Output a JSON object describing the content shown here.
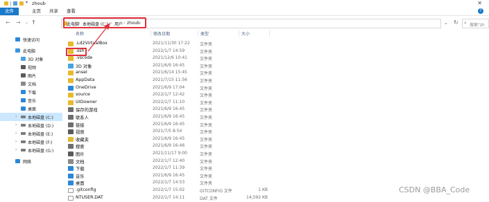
{
  "window": {
    "title": "zhoub"
  },
  "ribbon": {
    "file_tab": "文件",
    "tabs": [
      "主页",
      "共享",
      "查看"
    ],
    "help": "?"
  },
  "nav": {
    "back": "←",
    "forward": "→",
    "recent": "⌄",
    "up": "↑"
  },
  "address": {
    "crumbs": [
      "此电脑",
      "本地磁盘 (C:)",
      "用户",
      "zhoub"
    ],
    "sep": "›"
  },
  "search": {
    "placeholder": "搜索\"zh"
  },
  "sidebar": {
    "items": [
      {
        "label": "快速访问",
        "icon": "star-icon",
        "color": "#2b88d8"
      },
      {
        "label": "此电脑",
        "icon": "computer-icon",
        "color": "#3a96dd"
      },
      {
        "label": "3D 对象",
        "icon": "cube-icon",
        "color": "#4aa3df"
      },
      {
        "label": "视频",
        "icon": "video-icon",
        "color": "#5a5a5a"
      },
      {
        "label": "图片",
        "icon": "picture-icon",
        "color": "#5a5a5a"
      },
      {
        "label": "文档",
        "icon": "document-icon",
        "color": "#8a8a8a"
      },
      {
        "label": "下载",
        "icon": "download-icon",
        "color": "#2b88d8"
      },
      {
        "label": "音乐",
        "icon": "music-icon",
        "color": "#2b88d8"
      },
      {
        "label": "桌面",
        "icon": "desktop-icon",
        "color": "#2b88d8"
      },
      {
        "label": "本地磁盘 (C:)",
        "icon": "drive-icon",
        "color": "#7a7a7a",
        "selected": true
      },
      {
        "label": "本地磁盘 (D:)",
        "icon": "drive-icon",
        "color": "#7a7a7a"
      },
      {
        "label": "本地磁盘 (E:)",
        "icon": "drive-icon",
        "color": "#7a7a7a"
      },
      {
        "label": "本地磁盘 (F:)",
        "icon": "drive-icon",
        "color": "#7a7a7a"
      },
      {
        "label": "本地磁盘 (G:)",
        "icon": "drive-icon",
        "color": "#7a7a7a"
      },
      {
        "label": "网络",
        "icon": "network-icon",
        "color": "#2b88d8"
      }
    ]
  },
  "columns": {
    "name": "名称",
    "date": "修改日期",
    "type": "类型",
    "size": "大小"
  },
  "files": [
    {
      "name": ".Ld2VirtualBox",
      "date": "2021/11/30 17:22",
      "type": "文件夹",
      "size": "",
      "color": "#e8b92f"
    },
    {
      "name": ".ssh",
      "date": "2022/1/7 14:59",
      "type": "文件夹",
      "size": "",
      "color": "#e8b92f"
    },
    {
      "name": ".vscode",
      "date": "2021/12/6 10:41",
      "type": "文件夹",
      "size": "",
      "color": "#e8b92f"
    },
    {
      "name": "3D 对象",
      "date": "2021/6/9 16:45",
      "type": "文件夹",
      "size": "",
      "color": "#4aa3df"
    },
    {
      "name": "ansel",
      "date": "2021/6/14 15:45",
      "type": "文件夹",
      "size": "",
      "color": "#e8b92f"
    },
    {
      "name": "AppData",
      "date": "2021/7/15 11:56",
      "type": "文件夹",
      "size": "",
      "color": "#e8b92f"
    },
    {
      "name": "OneDrive",
      "date": "2021/6/9 17:04",
      "type": "文件夹",
      "size": "",
      "color": "#2b88d8"
    },
    {
      "name": "source",
      "date": "2022/1/7 12:42",
      "type": "文件夹",
      "size": "",
      "color": "#e8b92f"
    },
    {
      "name": "UIDowner",
      "date": "2022/1/7 11:10",
      "type": "文件夹",
      "size": "",
      "color": "#e8b92f"
    },
    {
      "name": "保存的游戏",
      "date": "2021/6/9 16:45",
      "type": "文件夹",
      "size": "",
      "color": "#6e6e6e"
    },
    {
      "name": "联系人",
      "date": "2021/6/9 16:45",
      "type": "文件夹",
      "size": "",
      "color": "#6e6e6e"
    },
    {
      "name": "链接",
      "date": "2021/6/9 16:45",
      "type": "文件夹",
      "size": "",
      "color": "#6e6e6e"
    },
    {
      "name": "视频",
      "date": "2021/7/5 8:54",
      "type": "文件夹",
      "size": "",
      "color": "#5a5a5a"
    },
    {
      "name": "收藏夹",
      "date": "2021/6/9 16:45",
      "type": "文件夹",
      "size": "",
      "color": "#e8b92f"
    },
    {
      "name": "搜索",
      "date": "2021/6/9 16:46",
      "type": "文件夹",
      "size": "",
      "color": "#6e6e6e"
    },
    {
      "name": "图片",
      "date": "2021/11/17 9:00",
      "type": "文件夹",
      "size": "",
      "color": "#5a5a5a"
    },
    {
      "name": "文档",
      "date": "2022/1/7 12:40",
      "type": "文件夹",
      "size": "",
      "color": "#8a8a8a"
    },
    {
      "name": "下载",
      "date": "2022/1/7 11:39",
      "type": "文件夹",
      "size": "",
      "color": "#2b88d8"
    },
    {
      "name": "音乐",
      "date": "2021/6/9 16:45",
      "type": "文件夹",
      "size": "",
      "color": "#2b88d8"
    },
    {
      "name": "桌面",
      "date": "2022/1/7 14:53",
      "type": "文件夹",
      "size": "",
      "color": "#2b88d8"
    },
    {
      "name": ".gitconfig",
      "date": "2022/1/7 15:02",
      "type": "GITCONFIG 文件",
      "size": "1 KB",
      "color": "#ffffff"
    },
    {
      "name": "NTUSER.DAT",
      "date": "2022/1/7 14:11",
      "type": "DAT 文件",
      "size": "14,592 KB",
      "color": "#ffffff"
    }
  ],
  "watermark": "CSDN @BBA_Code"
}
